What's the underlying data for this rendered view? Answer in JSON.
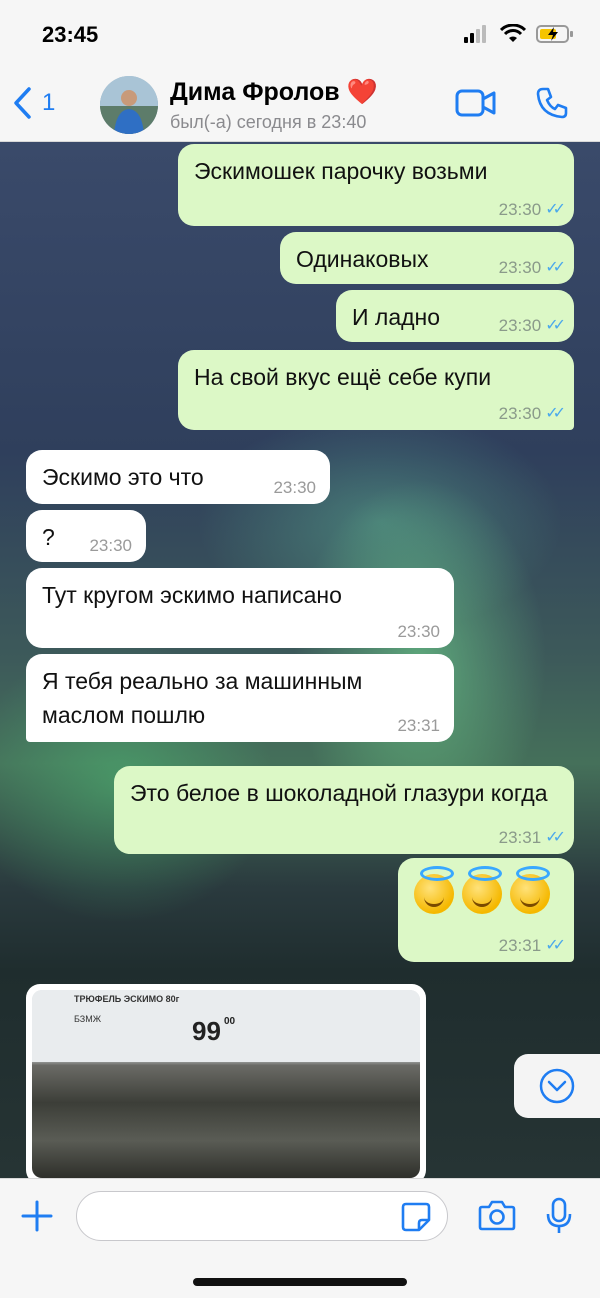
{
  "status_bar": {
    "time": "23:45"
  },
  "header": {
    "back_count": "1",
    "contact_name": "Дима Фролов ❤️",
    "contact_status": "был(-а) сегодня в 23:40"
  },
  "messages": [
    {
      "dir": "out",
      "text": "Эскимошек парочку возьми",
      "time": "23:30"
    },
    {
      "dir": "out",
      "text": "Одинаковых",
      "time": "23:30"
    },
    {
      "dir": "out",
      "text": "И ладно",
      "time": "23:30"
    },
    {
      "dir": "out",
      "text": "На свой вкус ещё себе купи",
      "time": "23:30"
    },
    {
      "dir": "in",
      "text": "Эскимо это что",
      "time": "23:30"
    },
    {
      "dir": "in",
      "text": "?",
      "time": "23:30"
    },
    {
      "dir": "in",
      "text": "Тут кругом эскимо написано",
      "time": "23:30"
    },
    {
      "dir": "in",
      "text": "Я тебя реально за машинным маслом пошлю",
      "time": "23:31"
    },
    {
      "dir": "out",
      "text": "Это белое в шоколадной глазури когда",
      "time": "23:31"
    },
    {
      "dir": "out",
      "text": "",
      "time": "23:31",
      "emoji": [
        "smiling-face-with-halo",
        "smiling-face-with-halo",
        "smiling-face-with-halo"
      ]
    }
  ],
  "photo": {
    "price_tag_name": "ТРЮФЕЛЬ ЭСКИМО 80г",
    "price_tag_small": "БЗМЖ",
    "price": "99",
    "cents": "00"
  },
  "input": {
    "placeholder": ""
  },
  "colors": {
    "accent": "#1f7df2",
    "outgoing_bubble": "#dcf8c6",
    "incoming_bubble": "#ffffff",
    "read_ticks": "#4aa8ec"
  }
}
